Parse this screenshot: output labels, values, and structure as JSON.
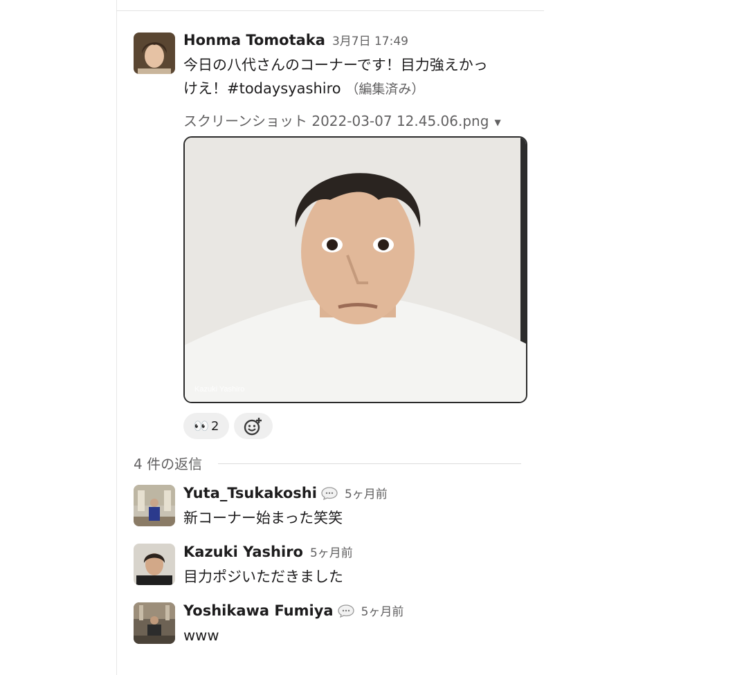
{
  "main_message": {
    "author": "Honma Tomotaka",
    "timestamp": "3月7日 17:49",
    "text_line1": "今日の八代さんのコーナーです！目力強えかっ",
    "text_line2": "けえ！#todaysyashiro",
    "edited": "（編集済み）",
    "attachment_name": "スクリーンショット 2022-03-07 12.45.06.png",
    "attachment_caption": "Kazuki Yashiro",
    "reactions": [
      {
        "emoji": "👀",
        "count": "2"
      }
    ]
  },
  "thread": {
    "reply_count_label": "4 件の返信",
    "replies": [
      {
        "author": "Yuta_Tsukakoshi",
        "time": "5ヶ月前",
        "text": "新コーナー始まった笑笑",
        "has_bubble": true
      },
      {
        "author": "Kazuki Yashiro",
        "time": "5ヶ月前",
        "text": "目力ポジいただきました",
        "has_bubble": false
      },
      {
        "author": "Yoshikawa Fumiya",
        "time": "5ヶ月前",
        "text": "www",
        "has_bubble": true
      }
    ]
  },
  "colors": {
    "text": "#1d1c1d",
    "muted": "#616061",
    "reaction_bg": "#efefef"
  },
  "icons": {
    "caret": "caret-down-icon",
    "reaction_add": "add-reaction-icon",
    "speech": "speech-bubble-icon"
  }
}
